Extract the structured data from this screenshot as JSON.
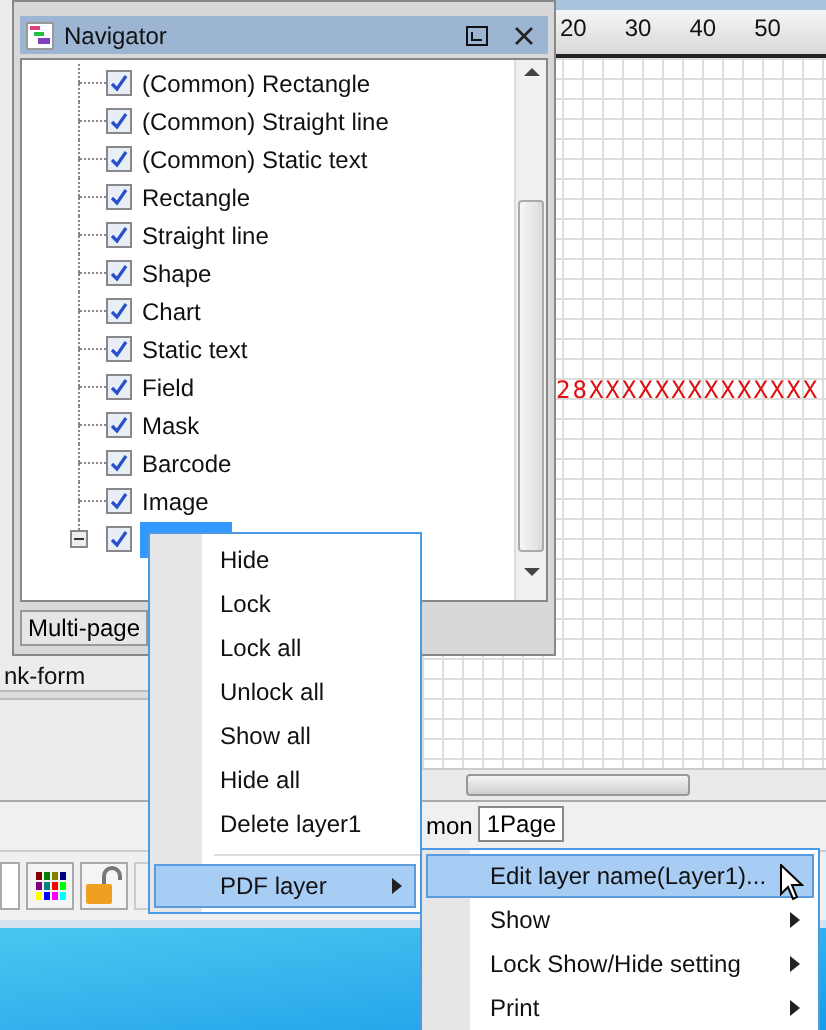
{
  "canvas": {
    "ruler_ticks": [
      "20",
      "30",
      "40",
      "50"
    ],
    "text": "28XXXXXXXXXXXXXX"
  },
  "form_label": "nk-form",
  "page_tabs": [
    {
      "label": "mon",
      "selected": false
    },
    {
      "label": "1Page",
      "selected": true
    }
  ],
  "navigator": {
    "title": "Navigator",
    "tree": [
      {
        "label": "(Common) Rectangle",
        "checked": true,
        "selected": false
      },
      {
        "label": "(Common) Straight line",
        "checked": true,
        "selected": false
      },
      {
        "label": "(Common) Static text",
        "checked": true,
        "selected": false
      },
      {
        "label": "Rectangle",
        "checked": true,
        "selected": false
      },
      {
        "label": "Straight line",
        "checked": true,
        "selected": false
      },
      {
        "label": "Shape",
        "checked": true,
        "selected": false
      },
      {
        "label": "Chart",
        "checked": true,
        "selected": false
      },
      {
        "label": "Static text",
        "checked": true,
        "selected": false
      },
      {
        "label": "Field",
        "checked": true,
        "selected": false
      },
      {
        "label": "Mask",
        "checked": true,
        "selected": false
      },
      {
        "label": "Barcode",
        "checked": true,
        "selected": false
      },
      {
        "label": "Image",
        "checked": true,
        "selected": false
      },
      {
        "checked": true,
        "selected": true,
        "expanded": true
      }
    ],
    "tabs": [
      "Multi-page"
    ]
  },
  "context_menu": {
    "items": [
      {
        "kind": "item",
        "label": "Hide",
        "selected": false
      },
      {
        "kind": "item",
        "label": "Lock",
        "selected": false
      },
      {
        "kind": "item",
        "label": "Lock all",
        "selected": false
      },
      {
        "kind": "item",
        "label": "Unlock all",
        "selected": false
      },
      {
        "kind": "item",
        "label": "Show all",
        "selected": false
      },
      {
        "kind": "item",
        "label": "Hide all",
        "selected": false
      },
      {
        "kind": "item",
        "label": "Delete layer1",
        "selected": false
      },
      {
        "kind": "separator"
      },
      {
        "kind": "submenu",
        "label": "PDF layer",
        "selected": true
      }
    ]
  },
  "submenu": {
    "items": [
      {
        "kind": "item",
        "label": "Edit layer name(Layer1)...",
        "selected": true
      },
      {
        "kind": "submenu",
        "label": "Show",
        "selected": false
      },
      {
        "kind": "submenu",
        "label": "Lock Show/Hide setting",
        "selected": false
      },
      {
        "kind": "submenu",
        "label": "Print",
        "selected": false
      }
    ]
  }
}
